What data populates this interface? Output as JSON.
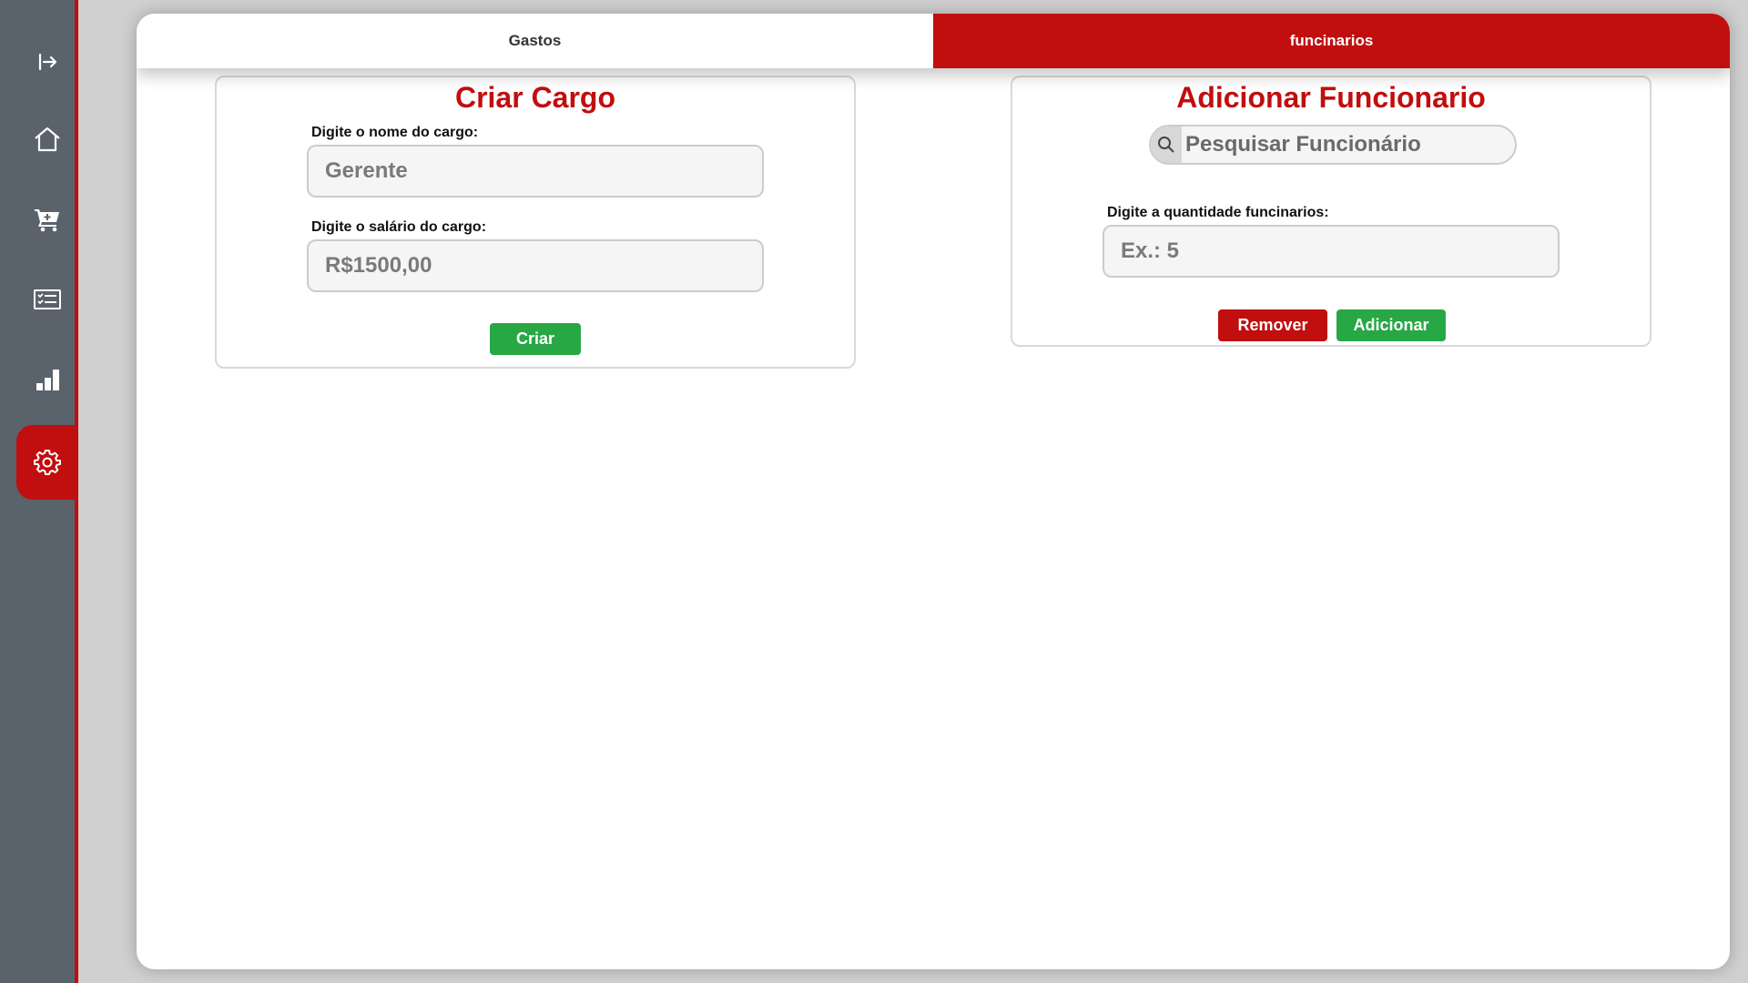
{
  "sidebar": {
    "items": [
      {
        "icon": "logout-icon",
        "active": false
      },
      {
        "icon": "home-icon",
        "active": false
      },
      {
        "icon": "cart-icon",
        "active": false
      },
      {
        "icon": "list-icon",
        "active": false
      },
      {
        "icon": "bar-chart-icon",
        "active": false
      },
      {
        "icon": "gear-icon",
        "active": true
      }
    ]
  },
  "tabs": [
    {
      "label": "Gastos",
      "active": false
    },
    {
      "label": "funcinarios",
      "active": true
    }
  ],
  "criar_cargo": {
    "title": "Criar Cargo",
    "name_label": "Digite o nome do cargo:",
    "name_placeholder": "Gerente",
    "salary_label": "Digite o salário do cargo:",
    "salary_placeholder": "R$1500,00",
    "create_button": "Criar"
  },
  "adicionar_funcionario": {
    "title": "Adicionar Funcionario",
    "search_placeholder": "Pesquisar Funcionário",
    "quantity_label": "Digite a quantidade funcinarios:",
    "quantity_placeholder": "Ex.: 5",
    "remove_button": "Remover",
    "add_button": "Adicionar"
  },
  "colors": {
    "accent_red": "#c10e0e",
    "sidebar_bg": "#5a626b",
    "button_green": "#28a745"
  }
}
